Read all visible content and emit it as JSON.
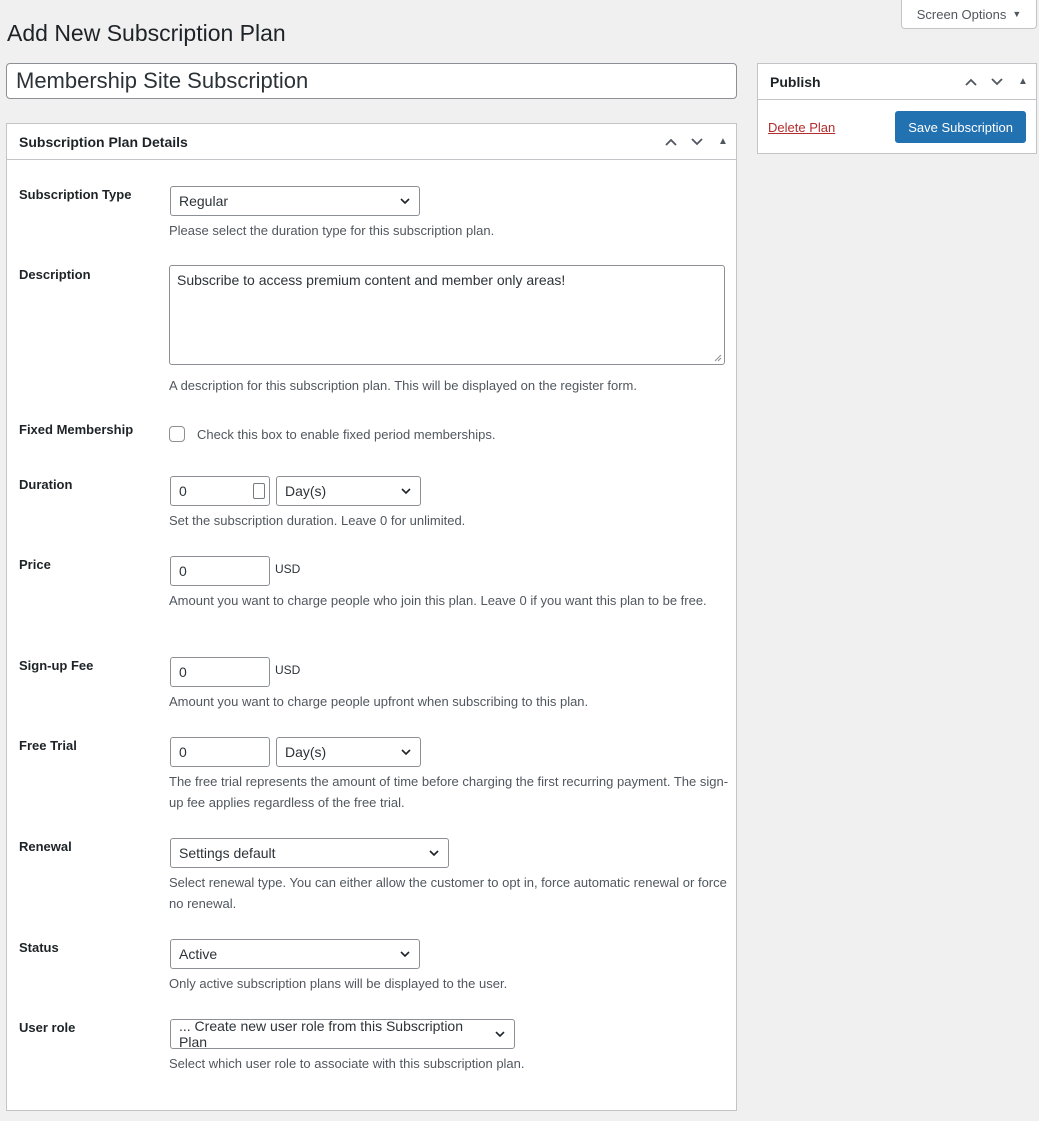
{
  "header": {
    "screen_options": "Screen Options",
    "page_title": "Add New Subscription Plan"
  },
  "plan_title_value": "Membership Site Subscription",
  "details_box": {
    "title": "Subscription Plan Details"
  },
  "publish_box": {
    "title": "Publish",
    "delete_label": "Delete Plan",
    "save_label": "Save Subscription"
  },
  "fields": {
    "subscription_type": {
      "label": "Subscription Type",
      "value": "Regular",
      "help": "Please select the duration type for this subscription plan."
    },
    "description": {
      "label": "Description",
      "value": "Subscribe to access premium content and member only areas!",
      "help": "A description for this subscription plan. This will be displayed on the register form."
    },
    "fixed_membership": {
      "label": "Fixed Membership",
      "checkbox_label": "Check this box to enable fixed period memberships.",
      "checked": false
    },
    "duration": {
      "label": "Duration",
      "value": "0",
      "unit": "Day(s)",
      "help": "Set the subscription duration. Leave 0 for unlimited."
    },
    "price": {
      "label": "Price",
      "value": "0",
      "currency": "USD",
      "help": "Amount you want to charge people who join this plan. Leave 0 if you want this plan to be free."
    },
    "signup_fee": {
      "label": "Sign-up Fee",
      "value": "0",
      "currency": "USD",
      "help": "Amount you want to charge people upfront when subscribing to this plan."
    },
    "free_trial": {
      "label": "Free Trial",
      "value": "0",
      "unit": "Day(s)",
      "help": "The free trial represents the amount of time before charging the first recurring payment. The sign-up fee applies regardless of the free trial."
    },
    "renewal": {
      "label": "Renewal",
      "value": "Settings default",
      "help": "Select renewal type. You can either allow the customer to opt in, force automatic renewal or force no renewal."
    },
    "status": {
      "label": "Status",
      "value": "Active",
      "help": "Only active subscription plans will be displayed to the user."
    },
    "user_role": {
      "label": "User role",
      "value": "... Create new user role from this Subscription Plan",
      "help": "Select which user role to associate with this subscription plan."
    }
  },
  "colors": {
    "primary_button": "#2271b1",
    "delete_link": "#b32d2e",
    "background": "#f0f0f1"
  }
}
